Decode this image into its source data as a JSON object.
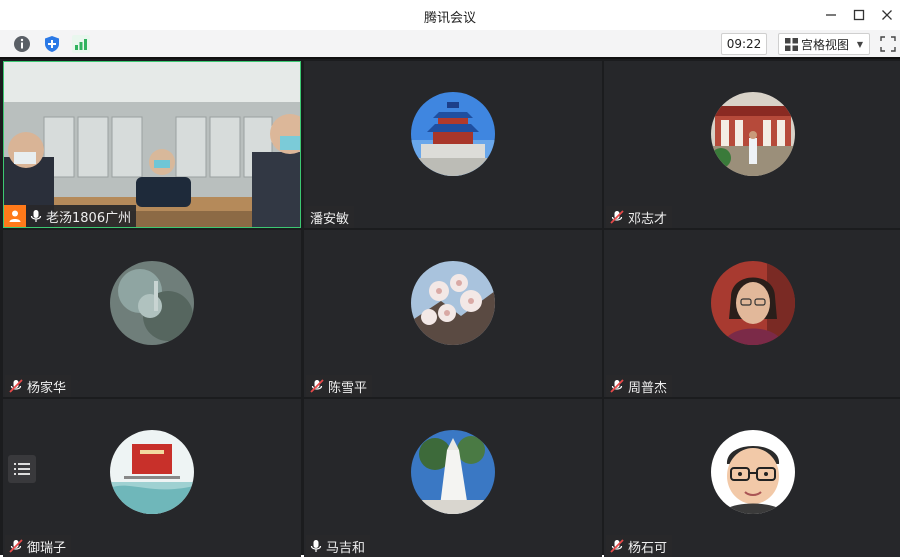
{
  "window": {
    "title": "腾讯会议"
  },
  "toolbar": {
    "clock": "09:22",
    "view_label": "宫格视图"
  },
  "participants": [
    {
      "name": "老汤1806广州",
      "muted": false,
      "speaking": true
    },
    {
      "name": "潘安敏",
      "muted": false,
      "speaking": false
    },
    {
      "name": "邓志才",
      "muted": true,
      "speaking": false
    },
    {
      "name": "杨家华",
      "muted": true,
      "speaking": false
    },
    {
      "name": "陈雪平",
      "muted": true,
      "speaking": false
    },
    {
      "name": "周普杰",
      "muted": true,
      "speaking": false
    },
    {
      "name": "御瑞子",
      "muted": true,
      "speaking": false
    },
    {
      "name": "马吉和",
      "muted": false,
      "speaking": false
    },
    {
      "name": "杨石可",
      "muted": true,
      "speaking": false
    }
  ],
  "colors": {
    "accent_green": "#3cc872",
    "speaker_orange": "#ff7a1a",
    "mute_red": "#e84a4a"
  }
}
